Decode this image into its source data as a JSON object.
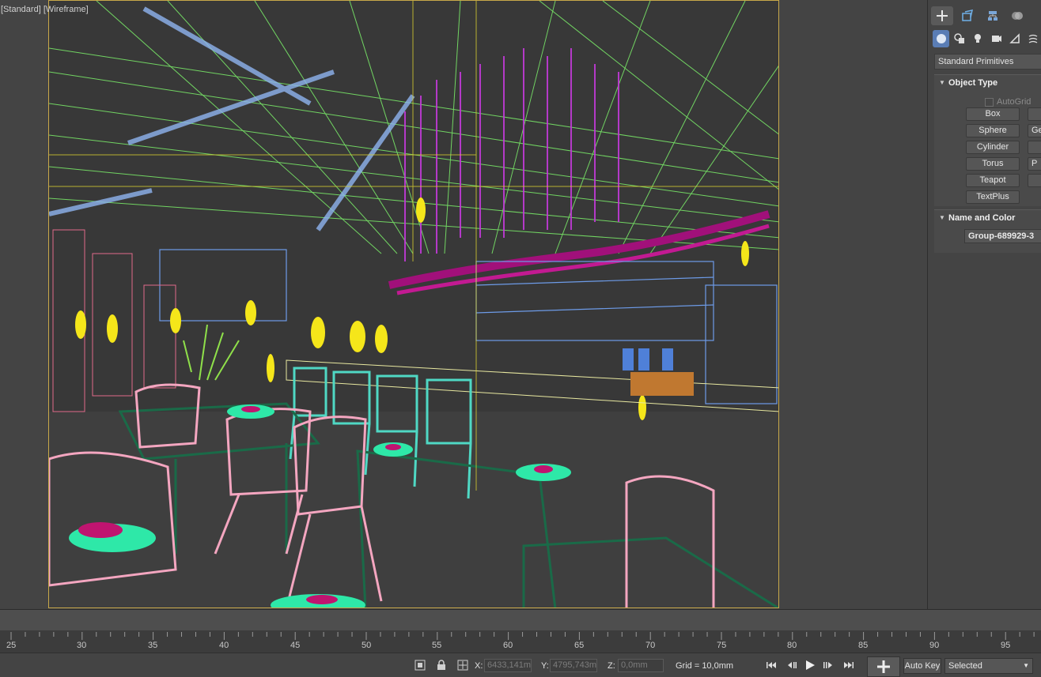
{
  "viewport": {
    "label_standard": "[Standard]",
    "label_shading": "[Wireframe]"
  },
  "command_panel": {
    "tabs": [
      "create-icon",
      "modify-icon",
      "hierarchy-icon",
      "motion-icon"
    ],
    "subtabs": [
      "geometry-icon",
      "shapes-icon",
      "lights-icon",
      "cameras-icon",
      "helpers-icon",
      "spacewarps-icon"
    ],
    "category": "Standard Primitives",
    "object_type": {
      "title": "Object Type",
      "autogrid": "AutoGrid",
      "buttons_left": [
        "Box",
        "Sphere",
        "Cylinder",
        "Torus",
        "Teapot",
        "TextPlus"
      ],
      "buttons_right_partial": [
        "",
        "Ge",
        "",
        "P",
        ""
      ]
    },
    "name_and_color": {
      "title": "Name and Color",
      "name_value": "Group-689929-3"
    }
  },
  "timeline": {
    "ticks": [
      "25",
      "30",
      "35",
      "40",
      "45",
      "50",
      "55",
      "60",
      "65",
      "70",
      "75",
      "80",
      "85",
      "90",
      "95"
    ]
  },
  "status_bar": {
    "x_label": "X:",
    "x_value": "6433,141m",
    "y_label": "Y:",
    "y_value": "4795,743m",
    "z_label": "Z:",
    "z_value": "0,0mm",
    "grid": "Grid = 10,0mm",
    "autokey": "Auto Key",
    "selection": "Selected"
  },
  "colors": {
    "background": "#444444",
    "viewport_border": "#c8a84a",
    "active_subtab": "#5a7db5"
  }
}
